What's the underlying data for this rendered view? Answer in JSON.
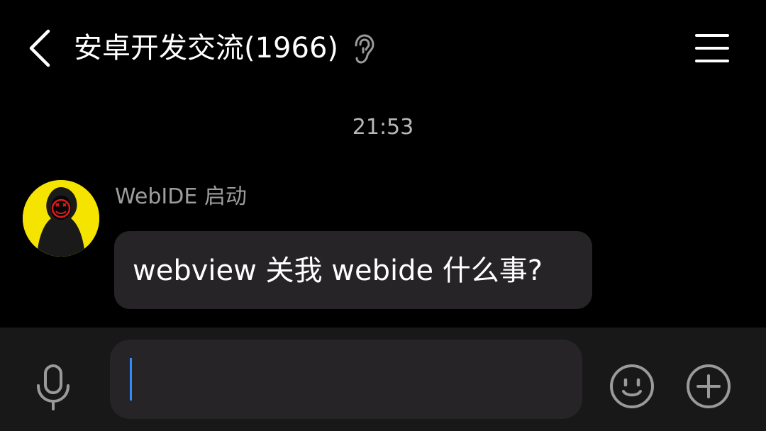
{
  "header": {
    "title": "安卓开发交流(1966)",
    "back_icon": "chevron-left-icon",
    "ear_icon": "ear-icon",
    "menu_icon": "hamburger-menu-icon"
  },
  "conversation": {
    "timestamp": "21:53",
    "messages": [
      {
        "sender": "WebIDE 启动",
        "text": "webview 关我 webide 什么事?",
        "avatar_icon": "hooded-figure-avatar"
      }
    ]
  },
  "input_bar": {
    "value": "",
    "mic_icon": "microphone-icon",
    "emoji_icon": "smiley-face-icon",
    "plus_icon": "plus-circle-icon"
  },
  "colors": {
    "background": "#000000",
    "bubble": "#262427",
    "input_bar": "#181818",
    "caret": "#2f8cff",
    "avatar_bg": "#f5e400"
  }
}
